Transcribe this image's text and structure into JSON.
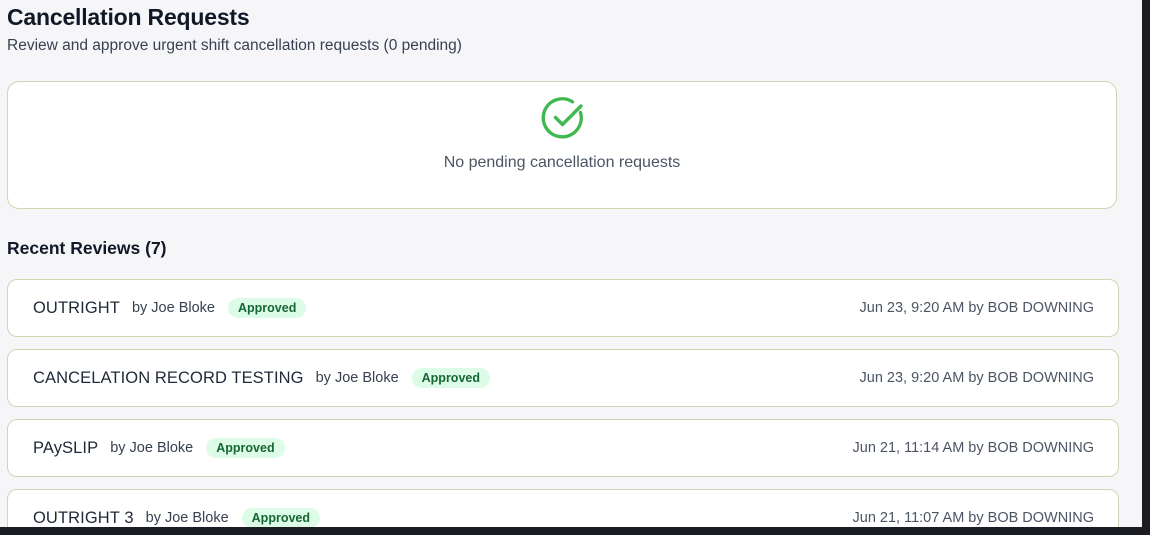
{
  "header": {
    "title": "Cancellation Requests",
    "subtitle": "Review and approve urgent shift cancellation requests (0 pending)"
  },
  "pending": {
    "icon": "check-circle-icon",
    "empty_message": "No pending cancellation requests",
    "icon_color": "#3fb950"
  },
  "recent": {
    "title": "Recent Reviews (7)",
    "items": [
      {
        "name": "OUTRIGHT",
        "author": "by Joe Bloke",
        "status": "Approved",
        "meta": "Jun 23, 9:20 AM by BOB DOWNING"
      },
      {
        "name": "CANCELATION RECORD TESTING",
        "author": "by Joe Bloke",
        "status": "Approved",
        "meta": "Jun 23, 9:20 AM by BOB DOWNING"
      },
      {
        "name": "PAySLIP",
        "author": "by Joe Bloke",
        "status": "Approved",
        "meta": "Jun 21, 11:14 AM by BOB DOWNING"
      },
      {
        "name": "OUTRIGHT 3",
        "author": "by Joe Bloke",
        "status": "Approved",
        "meta": "Jun 21, 11:07 AM by BOB DOWNING"
      }
    ]
  },
  "colors": {
    "card_border": "#d6d3b4",
    "badge_bg": "#dcfce7",
    "badge_text": "#166534"
  }
}
